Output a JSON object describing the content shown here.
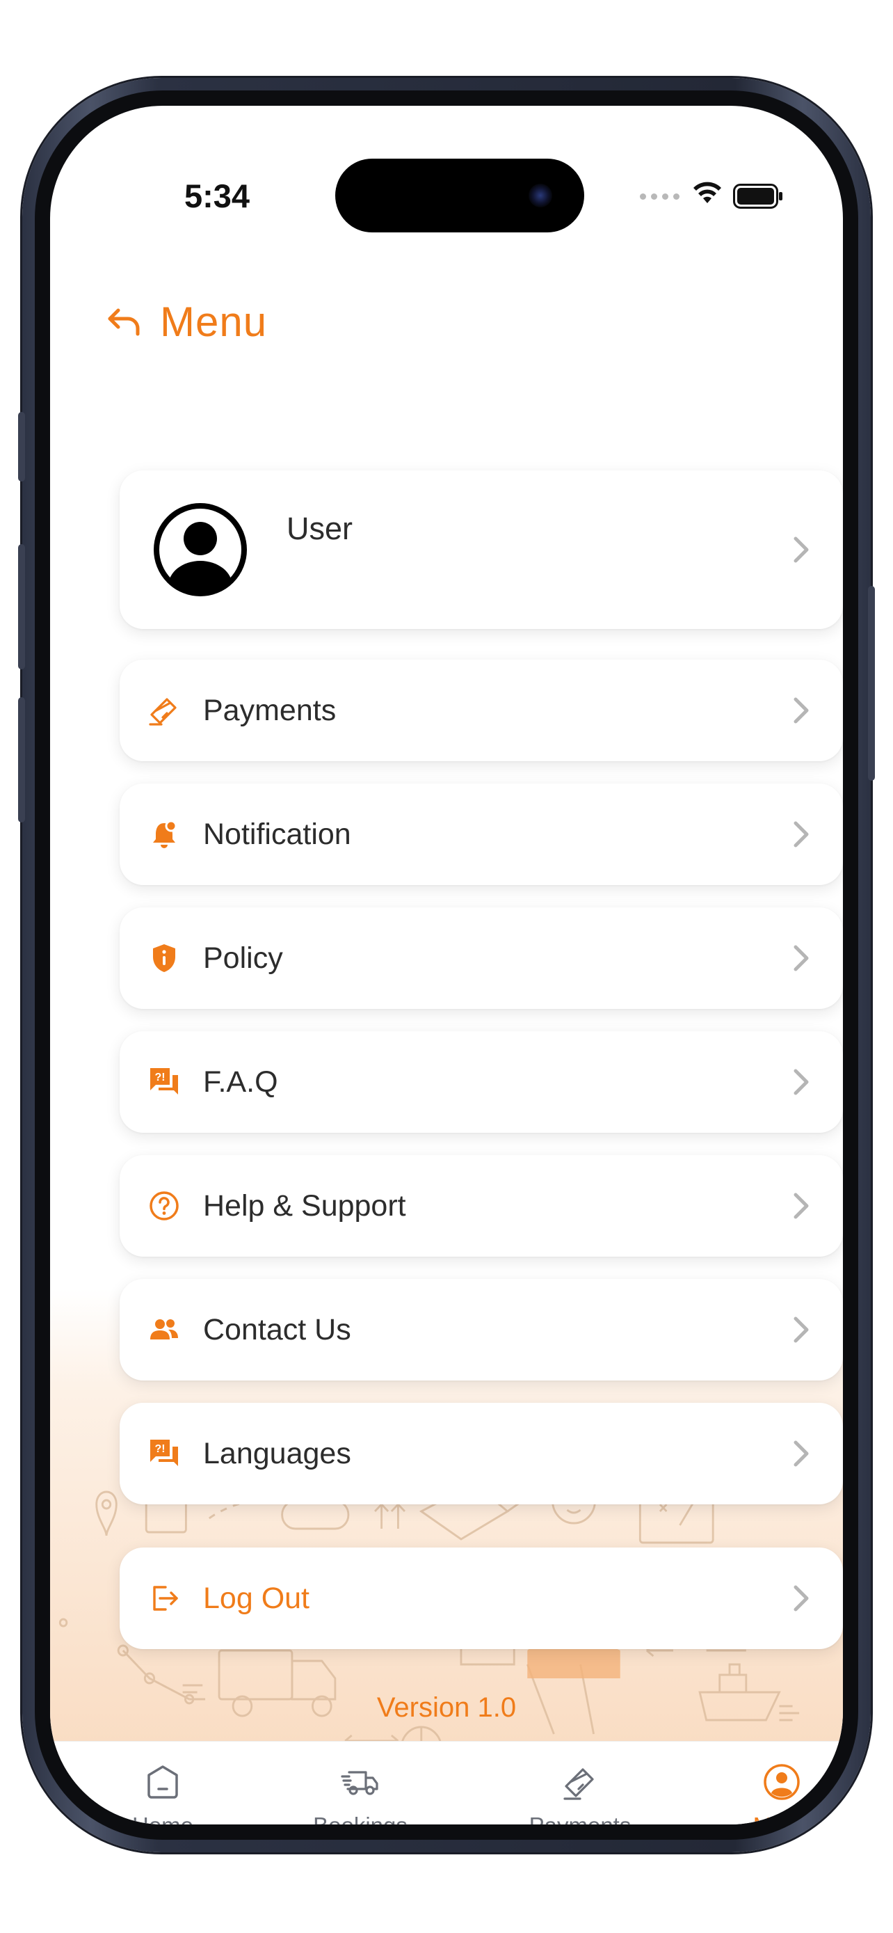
{
  "status_bar": {
    "time": "5:34"
  },
  "header": {
    "title": "Menu"
  },
  "user": {
    "name": "User"
  },
  "menu_items": [
    {
      "label": "Payments",
      "icon": "credit-card-icon"
    },
    {
      "label": "Notification",
      "icon": "bell-icon"
    },
    {
      "label": "Policy",
      "icon": "shield-info-icon"
    },
    {
      "label": "F.A.Q",
      "icon": "faq-chat-icon"
    },
    {
      "label": "Help & Support",
      "icon": "question-circle-icon"
    },
    {
      "label": "Contact Us",
      "icon": "users-icon"
    },
    {
      "label": "Languages",
      "icon": "language-chat-icon"
    }
  ],
  "logout": {
    "label": "Log Out",
    "icon": "logout-icon"
  },
  "version": "Version 1.0",
  "tabs": [
    {
      "label": "Home",
      "icon": "home-icon",
      "active": false
    },
    {
      "label": "Bookings",
      "icon": "truck-icon",
      "active": false
    },
    {
      "label": "Payments",
      "icon": "card-icon",
      "active": false
    },
    {
      "label": "Menu",
      "icon": "profile-icon",
      "active": true
    }
  ],
  "colors": {
    "accent": "#f07c1a",
    "text": "#2c2c2c",
    "chevron": "#b5b5b5",
    "tab_inactive": "#6b6f78"
  }
}
